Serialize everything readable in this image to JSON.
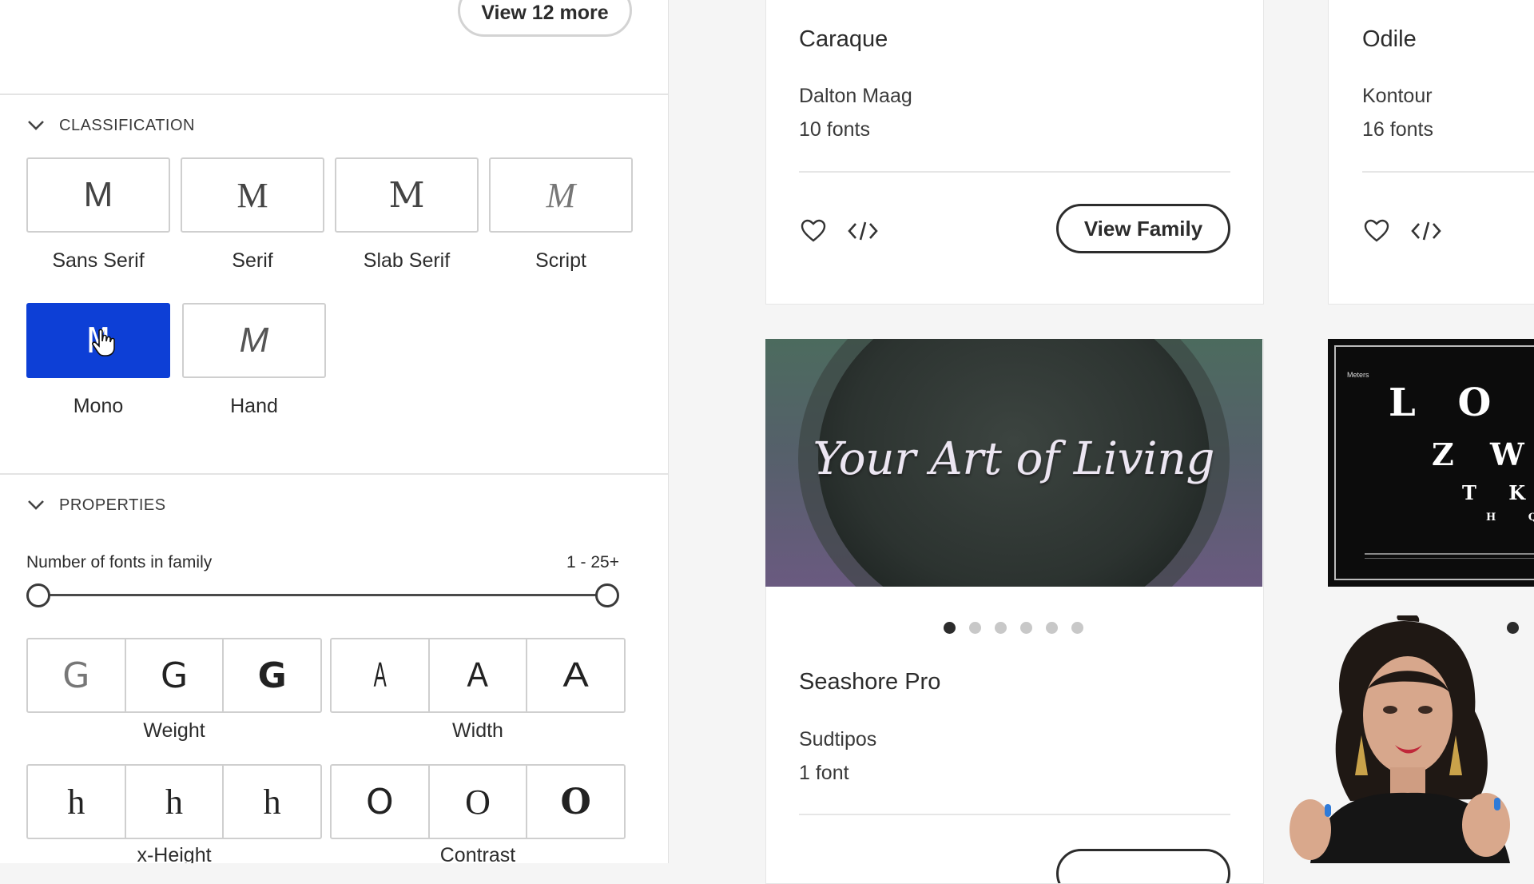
{
  "sidebar": {
    "view_more_label": "View 12 more",
    "classification": {
      "title": "CLASSIFICATION",
      "items": [
        {
          "glyph": "M",
          "label": "Sans Serif",
          "selected": false
        },
        {
          "glyph": "M",
          "label": "Serif",
          "selected": false
        },
        {
          "glyph": "M",
          "label": "Slab Serif",
          "selected": false
        },
        {
          "glyph": "M",
          "label": "Script",
          "selected": false
        },
        {
          "glyph": "M",
          "label": "Mono",
          "selected": true
        },
        {
          "glyph": "M",
          "label": "Hand",
          "selected": false
        }
      ]
    },
    "properties": {
      "title": "PROPERTIES",
      "fonts_in_family_label": "Number of fonts in family",
      "fonts_in_family_range": "1 - 25+",
      "weight": {
        "label": "Weight",
        "options": [
          "G",
          "G",
          "G"
        ]
      },
      "width": {
        "label": "Width",
        "options": [
          "A",
          "A",
          "A"
        ]
      },
      "xheight": {
        "label": "x-Height",
        "options": [
          "h",
          "h",
          "h"
        ]
      },
      "contrast": {
        "label": "Contrast",
        "options": [
          "O",
          "O",
          "O"
        ]
      }
    }
  },
  "cards": {
    "caraque": {
      "title": "Caraque",
      "foundry": "Dalton Maag",
      "count": "10 fonts",
      "view_label": "View Family"
    },
    "odile": {
      "title": "Odile",
      "foundry": "Kontour",
      "count": "16 fonts"
    },
    "seashore": {
      "title": "Seashore Pro",
      "foundry": "Sudtipos",
      "count": "1 font",
      "preview_text": "Your Art of Living",
      "carousel_dots": 6,
      "active_dot": 0
    },
    "odile_preview": {
      "row1": "L O C",
      "row2": "Z W",
      "row3": "T K",
      "row4": "H Q",
      "legend": "Meters"
    }
  },
  "colors": {
    "accent": "#0d3fd6",
    "border": "#cfcfcf",
    "text": "#2c2c2c"
  }
}
